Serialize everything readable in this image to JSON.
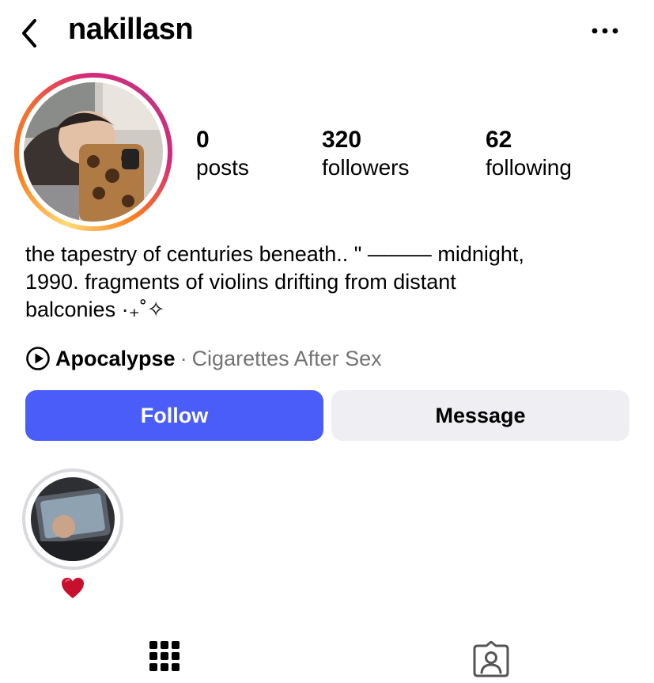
{
  "header": {
    "username": "nakillasn",
    "back_icon": "chevron-left-icon",
    "more_icon": "ellipsis-horizontal-icon"
  },
  "profile": {
    "avatar_icon": "profile-photo",
    "story_ring_colors": [
      "#feda75",
      "#fa7e1e",
      "#d62976",
      "#c13584"
    ]
  },
  "stats": [
    {
      "value": "0",
      "label": "posts"
    },
    {
      "value": "320",
      "label": "followers"
    },
    {
      "value": "62",
      "label": "following"
    }
  ],
  "bio": {
    "lines": [
      "the tapestry of centuries beneath.. \" ——— midnight,",
      "1990. fragments of violins drifting from distant",
      "balconies ·₊˚✧"
    ]
  },
  "music": {
    "song": "Apocalypse",
    "separator": "·",
    "artist": "Cigarettes After Sex",
    "icon": "play-circle-icon"
  },
  "actions": {
    "follow_label": "Follow",
    "message_label": "Message",
    "follow_color": "#4a5df9"
  },
  "highlights": [
    {
      "label": "❤️",
      "icon": "heart-icon"
    }
  ],
  "tabs": [
    {
      "icon": "grid-icon"
    },
    {
      "icon": "tagged-person-icon"
    }
  ]
}
